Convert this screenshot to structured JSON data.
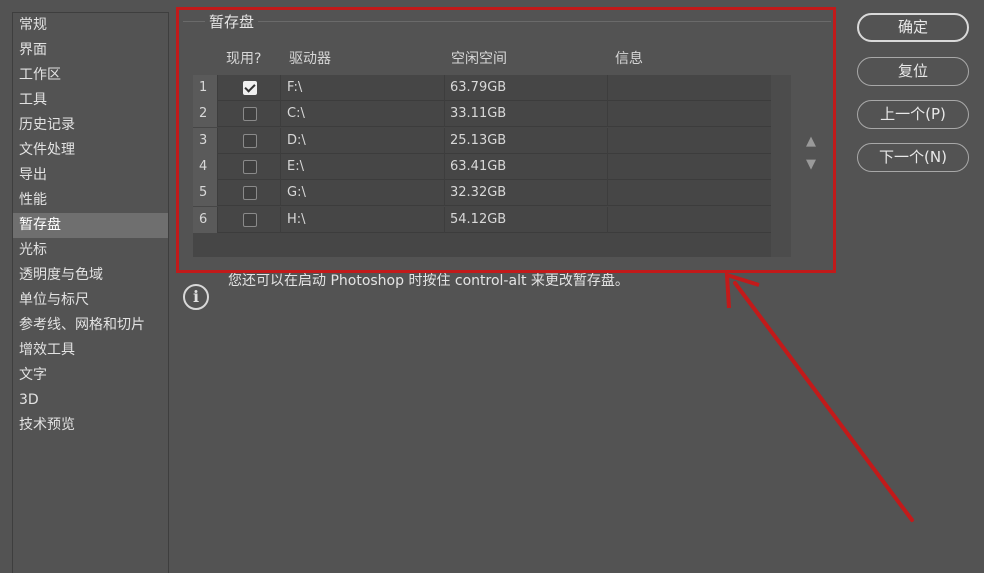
{
  "sidebar": {
    "items": [
      {
        "label": "常规",
        "active": false
      },
      {
        "label": "界面",
        "active": false
      },
      {
        "label": "工作区",
        "active": false
      },
      {
        "label": "工具",
        "active": false
      },
      {
        "label": "历史记录",
        "active": false
      },
      {
        "label": "文件处理",
        "active": false
      },
      {
        "label": "导出",
        "active": false
      },
      {
        "label": "性能",
        "active": false
      },
      {
        "label": "暂存盘",
        "active": true
      },
      {
        "label": "光标",
        "active": false
      },
      {
        "label": "透明度与色域",
        "active": false
      },
      {
        "label": "单位与标尺",
        "active": false
      },
      {
        "label": "参考线、网格和切片",
        "active": false
      },
      {
        "label": "增效工具",
        "active": false
      },
      {
        "label": "文字",
        "active": false
      },
      {
        "label": "3D",
        "active": false
      },
      {
        "label": "技术预览",
        "active": false
      }
    ]
  },
  "scratch": {
    "title": "暂存盘",
    "columns": {
      "active": "现用?",
      "drive": "驱动器",
      "free": "空闲空间",
      "info": "信息"
    },
    "rows": [
      {
        "index": "1",
        "checked": true,
        "drive": "F:\\",
        "free": "63.79GB",
        "info": ""
      },
      {
        "index": "2",
        "checked": false,
        "drive": "C:\\",
        "free": "33.11GB",
        "info": ""
      },
      {
        "index": "3",
        "checked": false,
        "drive": "D:\\",
        "free": "25.13GB",
        "info": ""
      },
      {
        "index": "4",
        "checked": false,
        "drive": "E:\\",
        "free": "63.41GB",
        "info": ""
      },
      {
        "index": "5",
        "checked": false,
        "drive": "G:\\",
        "free": "32.32GB",
        "info": ""
      },
      {
        "index": "6",
        "checked": false,
        "drive": "H:\\",
        "free": "54.12GB",
        "info": ""
      }
    ],
    "move_up_glyph": "▲",
    "move_down_glyph": "▼"
  },
  "hint": {
    "text": "您还可以在启动 Photoshop 时按住 control-alt 来更改暂存盘。",
    "icon": "info-icon"
  },
  "buttons": {
    "ok": "确定",
    "reset": "复位",
    "prev": "上一个(P)",
    "next": "下一个(N)"
  },
  "colors": {
    "annotation": "#c21a1a",
    "background": "#535353",
    "selected": "#6f6f6f"
  }
}
